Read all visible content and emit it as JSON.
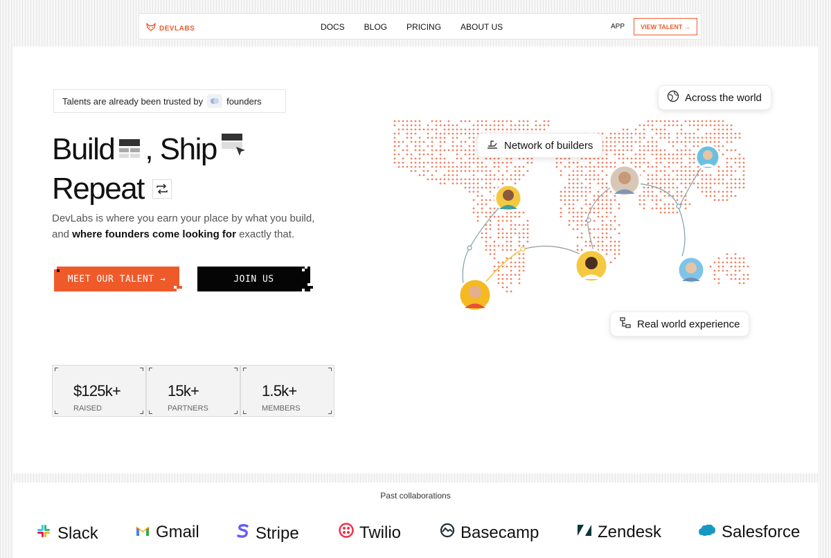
{
  "nav": {
    "logo_text": "DEVLABS",
    "links": [
      "DOCS",
      "BLOG",
      "PRICING",
      "ABOUT US"
    ],
    "app_label": "APP",
    "cta_label": "VIEW TALENT →"
  },
  "hero": {
    "trust_prefix": "Talents are already been trusted by",
    "trust_suffix": "founders",
    "line1_a": "Build",
    "line1_b": ", Ship",
    "line2": "Repeat",
    "sub_1": "DevLabs is where you earn your place by what you build, and ",
    "sub_bold": "where founders come looking for",
    "sub_2": " exactly that.",
    "primary_button": "MEET OUR TALENT →",
    "secondary_button": "JOIN US"
  },
  "stats": [
    {
      "value": "$125k+",
      "label": "RAISED"
    },
    {
      "value": "15k+",
      "label": "PARTNERS"
    },
    {
      "value": "1.5k+",
      "label": "MEMBERS"
    }
  ],
  "map": {
    "chip_world": "Across the world",
    "chip_network": "Network of builders",
    "chip_experience": "Real world experience"
  },
  "collab": {
    "title": "Past collaborations",
    "brands": [
      "Slack",
      "Gmail",
      "Stripe",
      "Twilio",
      "Basecamp",
      "Zendesk",
      "Salesforce"
    ]
  },
  "colors": {
    "accent": "#ef5a2b",
    "dark": "#050505"
  }
}
